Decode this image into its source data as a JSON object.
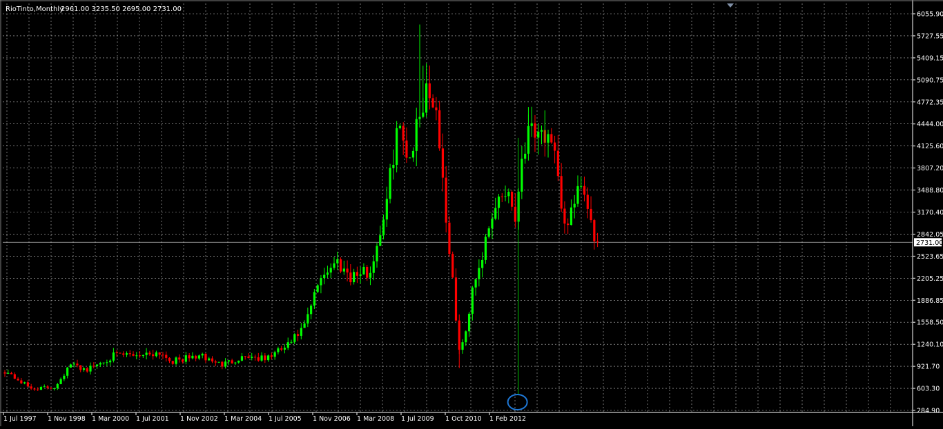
{
  "header": {
    "symbol_period": "RioTinto,Monthly",
    "ohlc": "2961.00 3235.50 2695.00 2731.00"
  },
  "colors": {
    "background": "#000000",
    "grid": "#c0c0c0",
    "axis_text": "#ffffff",
    "bull": "#00ff00",
    "bear": "#ff0000",
    "price_line": "#c0c0c0",
    "marker_line": "#00c000",
    "marker_circle": "#1e78d6",
    "label_bg": "#ffffff",
    "label_text": "#000000"
  },
  "chart_data": {
    "type": "candlestick",
    "ylim": [
      284.9,
      6200
    ],
    "y_ticks": [
      "6055.90",
      "5727.55",
      "5409.15",
      "5090.75",
      "4772.35",
      "4444.00",
      "4125.60",
      "3807.20",
      "3488.80",
      "3170.40",
      "2842.05",
      "2523.65",
      "2205.25",
      "1886.85",
      "1558.50",
      "1240.10",
      "921.70",
      "603.30",
      "284.90"
    ],
    "x_ticks": [
      "1 Jul 1997",
      "1 Nov 1998",
      "1 Mar 2000",
      "1 Jul 2001",
      "1 Nov 2002",
      "1 Mar 2004",
      "1 Jul 2005",
      "1 Nov 2006",
      "1 Mar 2008",
      "1 Jul 2009",
      "1 Oct 2010",
      "1 Feb 2012"
    ],
    "current_price": "2731.00",
    "marked_bar": "Jul 2010",
    "anchors": [
      {
        "t": "1997-07",
        "p": 860
      },
      {
        "t": "1998-03",
        "p": 600
      },
      {
        "t": "1998-10",
        "p": 620
      },
      {
        "t": "1999-03",
        "p": 950
      },
      {
        "t": "1999-08",
        "p": 880
      },
      {
        "t": "2000-04",
        "p": 1080
      },
      {
        "t": "2000-12",
        "p": 1100
      },
      {
        "t": "2001-06",
        "p": 1130
      },
      {
        "t": "2001-10",
        "p": 1000
      },
      {
        "t": "2002-06",
        "p": 1080
      },
      {
        "t": "2003-01",
        "p": 950
      },
      {
        "t": "2003-08",
        "p": 1080
      },
      {
        "t": "2004-02",
        "p": 1030
      },
      {
        "t": "2004-09",
        "p": 1230
      },
      {
        "t": "2005-02",
        "p": 1500
      },
      {
        "t": "2005-07",
        "p": 2250
      },
      {
        "t": "2005-12",
        "p": 2450
      },
      {
        "t": "2006-04",
        "p": 2250
      },
      {
        "t": "2006-10",
        "p": 2300
      },
      {
        "t": "2007-03",
        "p": 3300
      },
      {
        "t": "2007-06",
        "p": 4400
      },
      {
        "t": "2007-10",
        "p": 4000
      },
      {
        "t": "2008-03",
        "p": 5000
      },
      {
        "t": "2008-06",
        "p": 4700
      },
      {
        "t": "2008-09",
        "p": 3100
      },
      {
        "t": "2009-01",
        "p": 1150
      },
      {
        "t": "2009-03",
        "p": 1400
      },
      {
        "t": "2009-05",
        "p": 2100
      },
      {
        "t": "2009-09",
        "p": 2700
      },
      {
        "t": "2010-01",
        "p": 3400
      },
      {
        "t": "2010-04",
        "p": 3500
      },
      {
        "t": "2010-06",
        "p": 3050
      },
      {
        "t": "2010-08",
        "p": 4000
      },
      {
        "t": "2010-11",
        "p": 4500
      },
      {
        "t": "2011-03",
        "p": 4300
      },
      {
        "t": "2011-06",
        "p": 3900
      },
      {
        "t": "2011-09",
        "p": 3000
      },
      {
        "t": "2011-12",
        "p": 3200
      },
      {
        "t": "2012-02",
        "p": 3600
      },
      {
        "t": "2012-05",
        "p": 2950
      },
      {
        "t": "2012-07",
        "p": 2731
      }
    ]
  }
}
